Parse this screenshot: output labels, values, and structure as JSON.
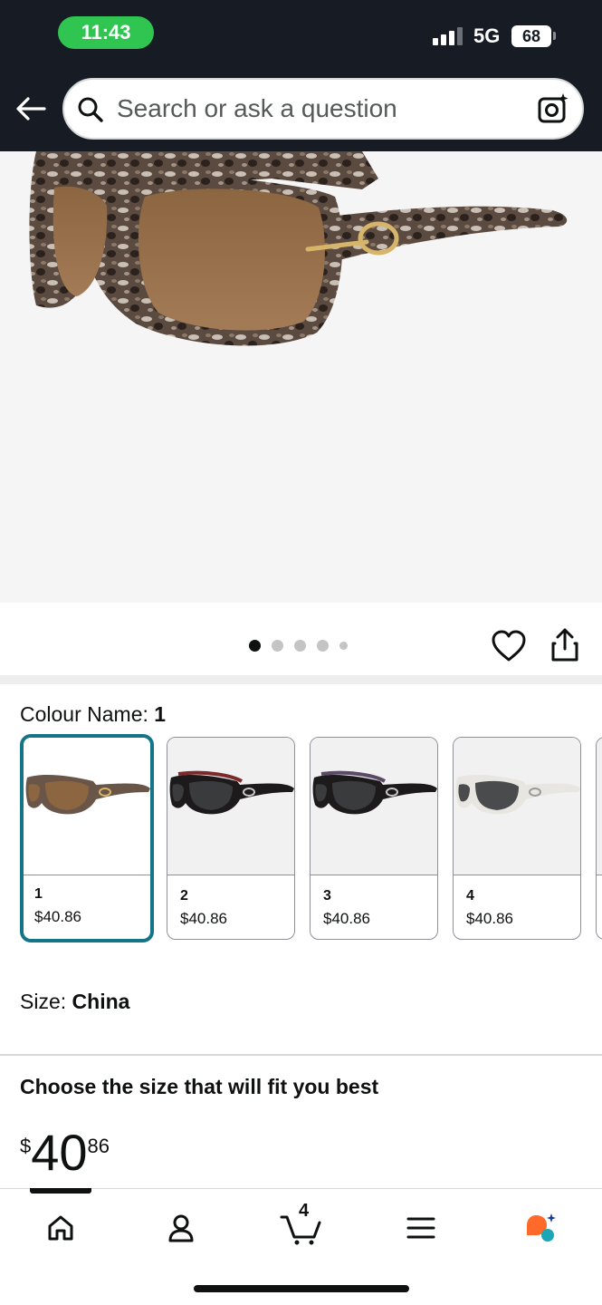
{
  "status_bar": {
    "time": "11:43",
    "network": "5G",
    "battery": "68"
  },
  "header": {
    "search_placeholder": "Search or ask a question"
  },
  "gallery": {
    "dot_count": 5,
    "active_index": 0
  },
  "colour": {
    "label": "Colour Name: ",
    "selected": "1",
    "options": [
      {
        "name": "1",
        "price": "$40.86",
        "frame": "tortoise-brown"
      },
      {
        "name": "2",
        "price": "$40.86",
        "frame": "black-red"
      },
      {
        "name": "3",
        "price": "$40.86",
        "frame": "black-purple"
      },
      {
        "name": "4",
        "price": "$40.86",
        "frame": "white-grey"
      }
    ]
  },
  "size": {
    "label": "Size: ",
    "value": "China"
  },
  "fit": {
    "title": "Choose the size that will fit you best"
  },
  "price": {
    "symbol": "$",
    "whole": "40",
    "fraction": "86"
  },
  "bottom_nav": {
    "cart_count": "4",
    "items": [
      "home-icon",
      "account-icon",
      "cart-icon",
      "menu-icon",
      "rufus-icon"
    ],
    "accent": "#ff6a2b"
  },
  "colors": {
    "header_bg": "#161b24",
    "selected_border": "#157588",
    "time_pill": "#2fc550"
  }
}
